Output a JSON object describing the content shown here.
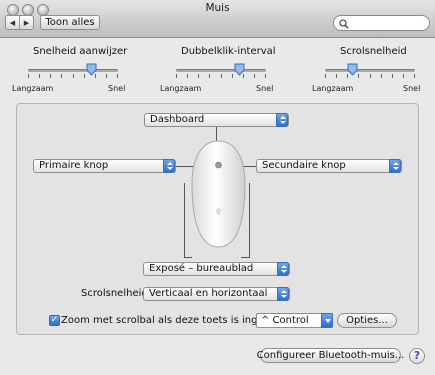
{
  "window": {
    "title": "Muis",
    "show_all_label": "Toon alles",
    "search_placeholder": ""
  },
  "sliders": [
    {
      "title": "Snelheid aanwijzer",
      "min_label": "Langzaam",
      "max_label": "Snel",
      "value_fraction": 0.7
    },
    {
      "title": "Dubbelklik-interval",
      "min_label": "Langzaam",
      "max_label": "Snel",
      "value_fraction": 0.7
    },
    {
      "title": "Scrolsnelheid",
      "min_label": "Langzaam",
      "max_label": "Snel",
      "value_fraction": 0.3
    }
  ],
  "mouse_buttons": {
    "top": "Dashboard",
    "left": "Primaire knop",
    "right": "Secundaire knop",
    "bottom": "Exposé – bureaublad"
  },
  "scroll": {
    "label": "Scrolsnelheid:",
    "value": "Verticaal en horizontaal"
  },
  "zoom": {
    "checked": true,
    "label": "Zoom met scrolbal als deze toets is ingedrukt:",
    "key": "^ Control",
    "options_label": "Opties..."
  },
  "footer": {
    "bluetooth_label": "Configureer Bluetooth-muis...",
    "help_label": "?"
  },
  "colors": {
    "accent": "#2a6fd1"
  }
}
